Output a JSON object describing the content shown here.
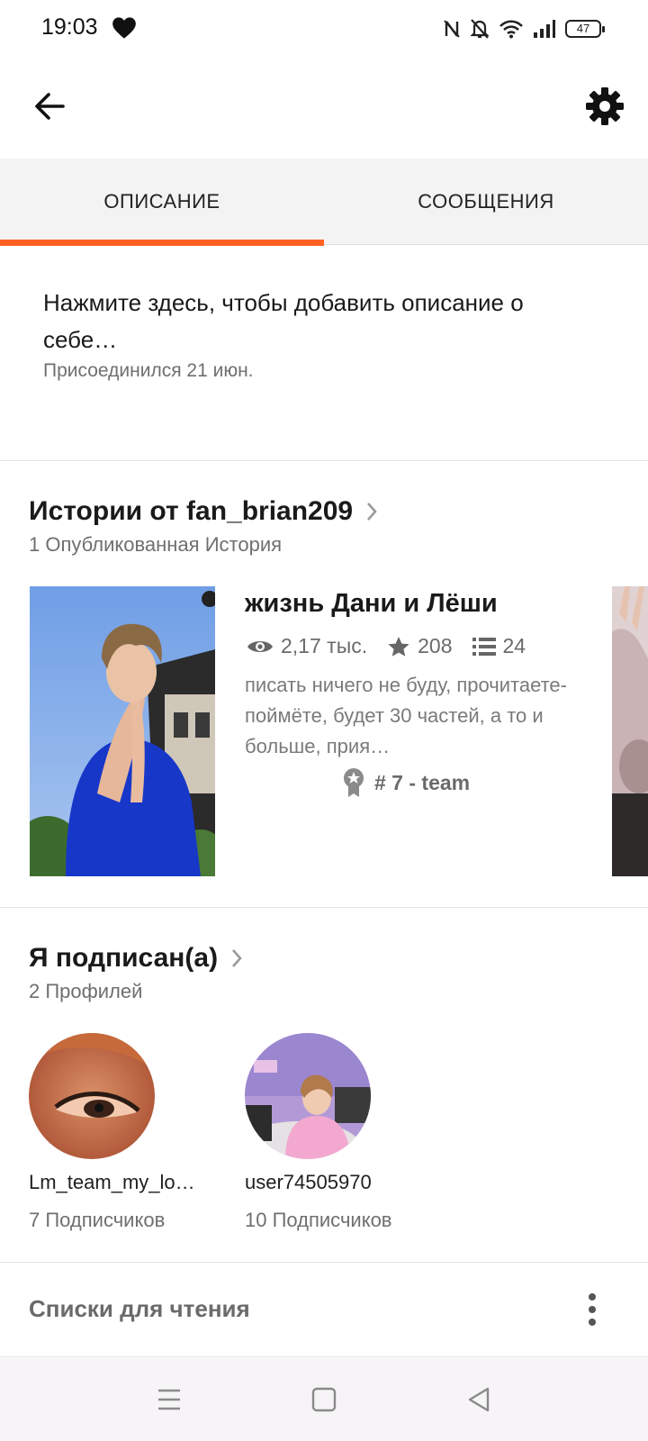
{
  "status_bar": {
    "time": "19:03",
    "battery": "47",
    "icons": [
      "heart-icon",
      "nfc-icon",
      "bell-off-icon",
      "wifi-icon",
      "signal-icon",
      "battery-icon"
    ]
  },
  "header": {
    "back_icon": "arrow-left-icon",
    "settings_icon": "gear-icon"
  },
  "tabs": [
    {
      "label": "ОПИСАНИЕ",
      "active": true
    },
    {
      "label": "СООБЩЕНИЯ",
      "active": false
    }
  ],
  "colors": {
    "accent": "#ff6122",
    "tab_background": "#f4f3f4",
    "secondary_text": "#6f6f6f"
  },
  "about": {
    "placeholder": "Нажмите здесь, чтобы добавить описание о себе…",
    "joined": "Присоединился 21 июн."
  },
  "stories_section": {
    "title": "Истории от fan_brian209",
    "subtitle": "1 Опубликованная История",
    "story": {
      "title": "жизнь Дани и Лёши",
      "reads": "2,17 тыс.",
      "votes": "208",
      "parts": "24",
      "description": "писать ничего не буду, прочитаете-поймёте, будет 30 частей, а то и больше, прия…",
      "rank": "# 7 - team"
    }
  },
  "following_section": {
    "title": "Я подписан(а)",
    "subtitle": "2 Профилей",
    "profiles": [
      {
        "name": "Lm_team_my_lo…",
        "followers": "7 Подписчиков"
      },
      {
        "name": "user74505970",
        "followers": "10 Подписчиков"
      }
    ]
  },
  "reading_lists": {
    "label": "Списки для чтения"
  },
  "nav_bar": {
    "icons": [
      "menu-icon",
      "home-square-icon",
      "back-triangle-icon"
    ]
  }
}
